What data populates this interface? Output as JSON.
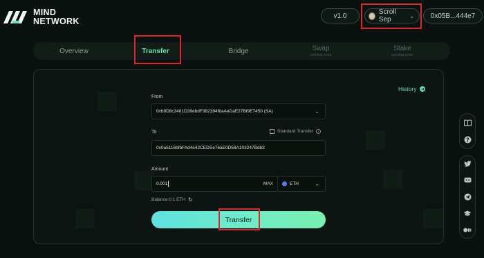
{
  "header": {
    "logo_line1": "MIND",
    "logo_line2": "NETWORK",
    "version": "v1.0",
    "network": "Scroll Sep",
    "address": "0x05B...444e7"
  },
  "tabs": [
    {
      "label": "Overview",
      "sub": ""
    },
    {
      "label": "Transfer",
      "sub": ""
    },
    {
      "label": "Bridge",
      "sub": ""
    },
    {
      "label": "Swap",
      "sub": "coming soon"
    },
    {
      "label": "Stake",
      "sub": "coming soon"
    }
  ],
  "form": {
    "history": "History",
    "from_label": "From",
    "from_value": "0xb9D8c3481D39ebdF382394fbaAeDaE27Bf9E7450  (SA)",
    "to_label": "To",
    "standard_transfer": "Standard Transfer",
    "to_value": "0x0a5116bfbFAd4e42CEDSe76aE0D58A103247Bdb3",
    "amount_label": "Amount",
    "amount_value": "0.001",
    "max": "MAX",
    "token": "ETH",
    "balance": "Balance:0.1 ETH",
    "transfer_button": "Transfer"
  },
  "colors": {
    "accent": "#64e2a8",
    "highlight": "#e0262a",
    "background": "#0a120f"
  },
  "icons": {
    "side_group1": [
      "docs-icon",
      "help-icon"
    ],
    "side_group2": [
      "twitter-icon",
      "discord-icon",
      "telegram-icon",
      "education-icon",
      "medium-icon"
    ]
  }
}
